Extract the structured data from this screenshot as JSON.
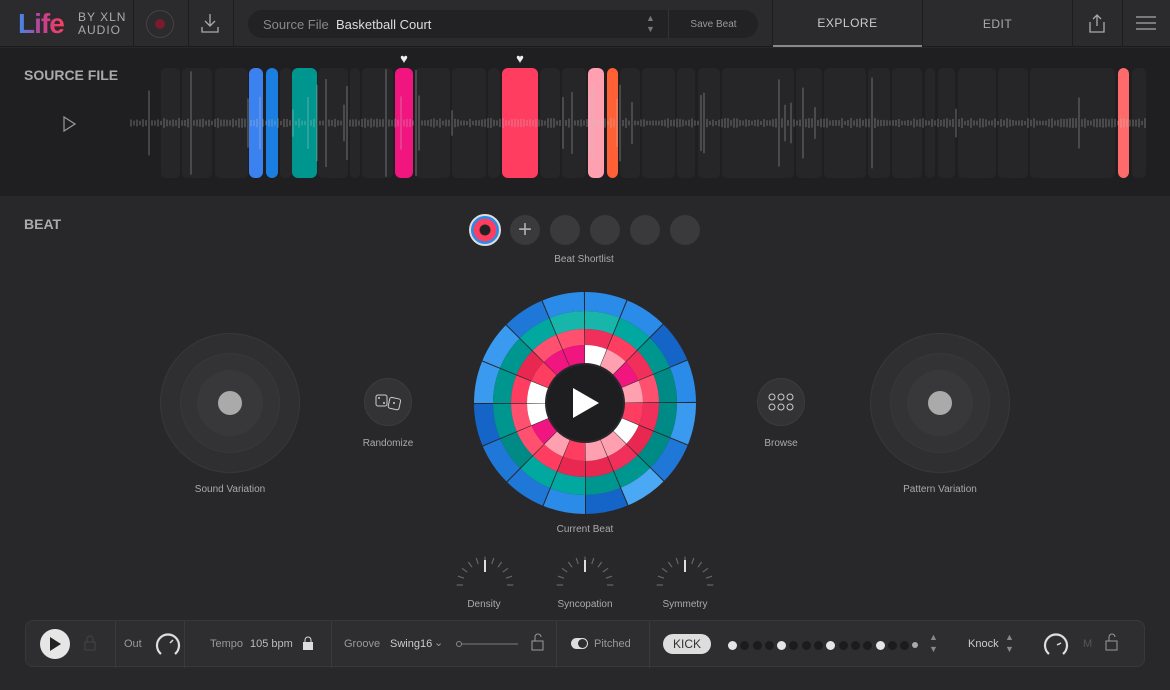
{
  "header": {
    "logo": "Life",
    "brand_line1": "BY XLN",
    "brand_line2": "AUDIO",
    "source_label": "Source File",
    "source_value": "Basketball Court",
    "save_beat": "Save Beat",
    "tabs": [
      {
        "label": "EXPLORE",
        "active": true
      },
      {
        "label": "EDIT",
        "active": false
      }
    ]
  },
  "source_panel": {
    "title": "SOURCE FILE",
    "slice_colors": [
      "#3b82f0",
      "#1a7fe0",
      "#009690",
      "#f0157f",
      "#ff3d60",
      "#ffa0b0",
      "#ff6035",
      "#ff6b6b"
    ],
    "favorited_slices": [
      3,
      4
    ]
  },
  "beat": {
    "title": "BEAT",
    "shortlist_label": "Beat Shortlist",
    "sound_variation": "Sound Variation",
    "pattern_variation": "Pattern Variation",
    "randomize": "Randomize",
    "browse": "Browse",
    "current_beat": "Current Beat",
    "dials": [
      "Density",
      "Syncopation",
      "Symmetry"
    ]
  },
  "bottom": {
    "out": "Out",
    "tempo_label": "Tempo",
    "tempo_value": "105 bpm",
    "groove_label": "Groove",
    "groove_value": "Swing16",
    "pitched": "Pitched",
    "pitched_on": true,
    "instrument": "KICK",
    "steps": [
      1,
      0,
      0,
      0,
      1,
      0,
      0,
      0,
      1,
      0,
      0,
      0,
      1,
      0,
      0,
      0.5
    ],
    "sound": "Knock",
    "mute": "M"
  },
  "colors": {
    "accent_red": "#ff3d60",
    "accent_blue": "#2a8be8",
    "teal": "#009690"
  }
}
